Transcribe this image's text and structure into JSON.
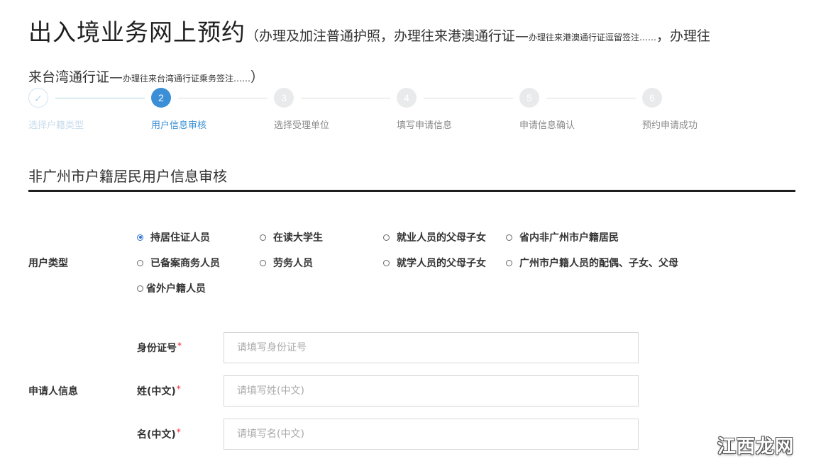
{
  "header": {
    "title_main": "出入境业务网上预约",
    "paren_open": "（办理及加注普通护照，办理往来港澳通行证—",
    "paren_small1": "办理往来港澳通行证逗留签注……",
    "paren_comma": "，办理往",
    "line2_mid": "来台湾通行证—",
    "paren_small2": "办理往来台湾通行证乘务签注……",
    "paren_close": "）"
  },
  "stepper": {
    "steps": [
      {
        "number": "✓",
        "label": "选择户籍类型",
        "state": "done"
      },
      {
        "number": "2",
        "label": "用户信息审核",
        "state": "active"
      },
      {
        "number": "3",
        "label": "选择受理单位",
        "state": "todo"
      },
      {
        "number": "4",
        "label": "填写申请信息",
        "state": "todo"
      },
      {
        "number": "5",
        "label": "申请信息确认",
        "state": "todo"
      },
      {
        "number": "6",
        "label": "预约申请成功",
        "state": "todo"
      }
    ]
  },
  "section": {
    "title": "非广州市户籍居民用户信息审核"
  },
  "user_type": {
    "label": "用户类型",
    "options": [
      {
        "label": "持居住证人员",
        "checked": true
      },
      {
        "label": "在读大学生",
        "checked": false
      },
      {
        "label": "就业人员的父母子女",
        "checked": false
      },
      {
        "label": "省内非广州市户籍居民",
        "checked": false
      },
      {
        "label": "已备案商务人员",
        "checked": false
      },
      {
        "label": "劳务人员",
        "checked": false
      },
      {
        "label": "就学人员的父母子女",
        "checked": false
      },
      {
        "label": "广州市户籍人员的配偶、子女、父母",
        "checked": false
      },
      {
        "label": "省外户籍人员",
        "checked": false
      }
    ]
  },
  "applicant": {
    "label": "申请人信息",
    "fields": [
      {
        "label": "身份证号",
        "required_mark": "*",
        "value": "",
        "placeholder": "请填写身份证号"
      },
      {
        "label": "姓(中文)",
        "required_mark": "*",
        "value": "",
        "placeholder": "请填写姓(中文)"
      },
      {
        "label": "名(中文)",
        "required_mark": "*",
        "value": "",
        "placeholder": "请填写名(中文)"
      }
    ]
  },
  "watermark": {
    "text": "江西龙网"
  },
  "colors": {
    "accent": "#3a8fd6",
    "required": "#ee2233",
    "rule": "#1f1f1f"
  }
}
